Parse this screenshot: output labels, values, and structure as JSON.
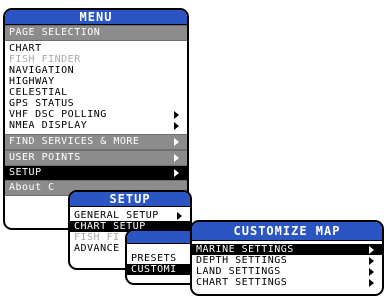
{
  "menu": {
    "title": "MENU",
    "page_selection": "PAGE SELECTION",
    "items": [
      "CHART",
      "FISH FINDER",
      "NAVIGATION",
      "HIGHWAY",
      "CELESTIAL",
      "GPS STATUS",
      "VHF DSC POLLING",
      "NMEA DISPLAY"
    ],
    "find_services": "FIND SERVICES & MORE",
    "user_points": "USER POINTS",
    "setup": "SETUP",
    "about": "About C"
  },
  "setup": {
    "title": "SETUP",
    "items": [
      "GENERAL SETUP",
      "CHART SETUP",
      "FISH FI",
      "ADVANCE"
    ]
  },
  "chart_sub": {
    "items": [
      "PRESETS",
      "CUSTOMI"
    ]
  },
  "customize": {
    "title": "CUSTOMIZE MAP",
    "items": [
      "MARINE SETTINGS",
      "DEPTH SETTINGS",
      "LAND SETTINGS",
      "CHART SETTINGS"
    ]
  },
  "colors": {
    "title_blue": "#2b55c2",
    "section_gray": "#8c8c8c",
    "selected": "#000000",
    "disabled": "#a8a8a8"
  }
}
